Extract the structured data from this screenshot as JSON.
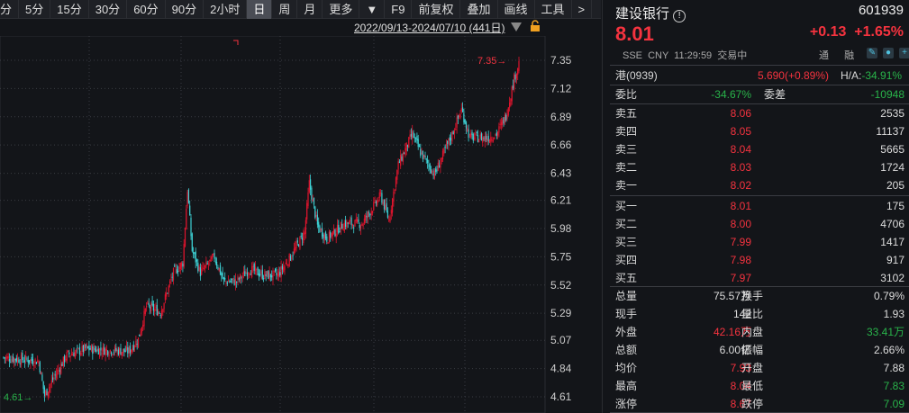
{
  "toolbar": {
    "items": [
      "分",
      "5分",
      "15分",
      "30分",
      "60分",
      "90分",
      "2小时",
      "日",
      "周",
      "月",
      "更多",
      "▼",
      "F9",
      "前复权",
      "叠加",
      "画线",
      "工具",
      ">"
    ],
    "active": "日"
  },
  "chart_header": {
    "range": "2022/09/13-2024/07/10 (441日)"
  },
  "chart_data": {
    "type": "candlestick",
    "title": "建设银行 日K",
    "x_range": [
      "2022/09/13",
      "2024/07/10"
    ],
    "count": 441,
    "yticks": [
      7.35,
      7.12,
      6.89,
      6.66,
      6.43,
      6.21,
      5.98,
      5.75,
      5.52,
      5.29,
      5.07,
      4.84,
      4.61
    ],
    "ylim": [
      4.61,
      7.35
    ],
    "max_label": "7.35",
    "min_label": "4.61",
    "close_path": [
      [
        0,
        4.93
      ],
      [
        30,
        4.9
      ],
      [
        35,
        4.62
      ],
      [
        42,
        4.75
      ],
      [
        54,
        4.95
      ],
      [
        70,
        5.0
      ],
      [
        107,
        4.98
      ],
      [
        115,
        5.08
      ],
      [
        122,
        5.35
      ],
      [
        134,
        5.3
      ],
      [
        145,
        5.62
      ],
      [
        153,
        5.7
      ],
      [
        157,
        6.3
      ],
      [
        161,
        5.8
      ],
      [
        168,
        5.62
      ],
      [
        180,
        5.75
      ],
      [
        188,
        5.55
      ],
      [
        199,
        5.55
      ],
      [
        210,
        5.65
      ],
      [
        222,
        5.6
      ],
      [
        234,
        5.6
      ],
      [
        245,
        5.75
      ],
      [
        257,
        5.95
      ],
      [
        261,
        6.35
      ],
      [
        268,
        6.0
      ],
      [
        276,
        5.9
      ],
      [
        291,
        6.02
      ],
      [
        306,
        6.02
      ],
      [
        322,
        6.25
      ],
      [
        329,
        6.05
      ],
      [
        337,
        6.5
      ],
      [
        349,
        6.75
      ],
      [
        356,
        6.6
      ],
      [
        368,
        6.42
      ],
      [
        383,
        6.75
      ],
      [
        391,
        6.95
      ],
      [
        398,
        6.72
      ],
      [
        414,
        6.72
      ],
      [
        421,
        6.75
      ],
      [
        429,
        6.9
      ],
      [
        436,
        7.2
      ],
      [
        440,
        7.33
      ]
    ],
    "up_color": "#e0142d",
    "down_color": "#3ed3d6"
  },
  "quote": {
    "name": "建设银行",
    "code": "601939",
    "price": "8.01",
    "change": "+0.13",
    "pct": "+1.65%",
    "exchange": "SSE",
    "currency": "CNY",
    "time": "11:29:59",
    "status": "交易中",
    "tong": "通",
    "rong": "融"
  },
  "hk": {
    "label": "港(0939)",
    "value": "5.690(+0.89%)",
    "ha_label": "H/A:",
    "ha": "-34.91%"
  },
  "wei": {
    "label": "委比",
    "value": "-34.67%",
    "label2": "委差",
    "value2": "-10948"
  },
  "asks": [
    {
      "label": "卖五",
      "price": "8.06",
      "vol": "2535"
    },
    {
      "label": "卖四",
      "price": "8.05",
      "vol": "11137"
    },
    {
      "label": "卖三",
      "price": "8.04",
      "vol": "5665"
    },
    {
      "label": "卖二",
      "price": "8.03",
      "vol": "1724"
    },
    {
      "label": "卖一",
      "price": "8.02",
      "vol": "205"
    }
  ],
  "bids": [
    {
      "label": "买一",
      "price": "8.01",
      "vol": "175"
    },
    {
      "label": "买二",
      "price": "8.00",
      "vol": "4706"
    },
    {
      "label": "买三",
      "price": "7.99",
      "vol": "1417"
    },
    {
      "label": "买四",
      "price": "7.98",
      "vol": "917"
    },
    {
      "label": "买五",
      "price": "7.97",
      "vol": "3102"
    }
  ],
  "stats": [
    {
      "l1": "总量",
      "v1": "75.57万",
      "c1": "white",
      "l2": "换手",
      "v2": "0.79%",
      "c2": "white"
    },
    {
      "l1": "现手",
      "v1": "142",
      "c1": "white",
      "l2": "量比",
      "v2": "1.93",
      "c2": "white"
    },
    {
      "l1": "外盘",
      "v1": "42.16万",
      "c1": "red",
      "l2": "内盘",
      "v2": "33.41万",
      "c2": "green"
    },
    {
      "l1": "总额",
      "v1": "6.00亿",
      "c1": "white",
      "l2": "振幅",
      "v2": "2.66%",
      "c2": "white"
    },
    {
      "l1": "均价",
      "v1": "7.93",
      "c1": "red",
      "l2": "开盘",
      "v2": "7.88",
      "c2": "white"
    },
    {
      "l1": "最高",
      "v1": "8.04",
      "c1": "red",
      "l2": "最低",
      "v2": "7.83",
      "c2": "green"
    },
    {
      "l1": "涨停",
      "v1": "8.67",
      "c1": "red",
      "l2": "跌停",
      "v2": "7.09",
      "c2": "green"
    }
  ]
}
